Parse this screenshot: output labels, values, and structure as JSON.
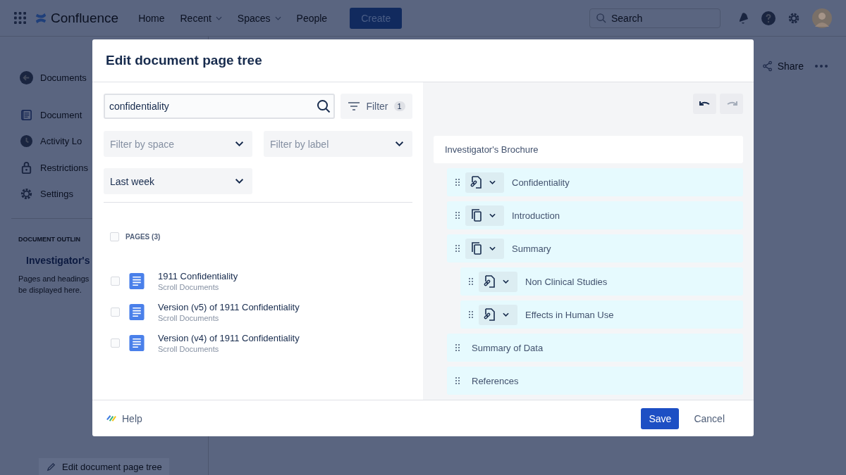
{
  "top_nav": {
    "product": "Confluence",
    "links": [
      {
        "label": "Home",
        "dropdown": false
      },
      {
        "label": "Recent",
        "dropdown": true
      },
      {
        "label": "Spaces",
        "dropdown": true
      },
      {
        "label": "People",
        "dropdown": false
      }
    ],
    "create": "Create",
    "search": {
      "placeholder": "Search"
    }
  },
  "sidebar": {
    "back": "Documents",
    "items": [
      {
        "label": "Document",
        "kind": "document"
      },
      {
        "label": "Activity Lo",
        "kind": "clock"
      },
      {
        "label": "Restrictions",
        "kind": "lock"
      },
      {
        "label": "Settings",
        "kind": "gear"
      }
    ],
    "outline_heading": "DOCUMENT OUTLIN",
    "outline_item": "Investigator's",
    "outline_note": [
      "Pages and headings",
      "be displayed here."
    ],
    "edit_link": "Edit document page tree"
  },
  "page_actions": {
    "share": "Share"
  },
  "dialog": {
    "title": "Edit document page tree",
    "search": {
      "value": "confidentiality"
    },
    "filter": {
      "label": "Filter",
      "count": "1"
    },
    "selects": [
      {
        "placeholder": "Filter by space"
      },
      {
        "placeholder": "Filter by label"
      },
      {
        "value": "Last week"
      }
    ],
    "pages": {
      "heading": "PAGES (3)",
      "checked": false,
      "results": [
        {
          "title": "1911 Confidentiality",
          "space": "Scroll Documents",
          "checked": false
        },
        {
          "title": "Version (v5) of 1911 Confidentiality",
          "space": "Scroll Documents",
          "checked": false
        },
        {
          "title": "Version (v4) of 1911 Confidentiality",
          "space": "Scroll Documents",
          "checked": false
        }
      ]
    },
    "history": {
      "undo_disabled": false,
      "redo_disabled": true
    },
    "tree": {
      "root": "Investigator's Brochure",
      "children": [
        {
          "label": "Confidentiality",
          "kind": "linked"
        },
        {
          "label": "Introduction",
          "kind": "copy"
        },
        {
          "label": "Summary",
          "kind": "copy",
          "children": [
            {
              "label": "Non Clinical Studies",
              "kind": "linked"
            },
            {
              "label": "Effects in Human Use",
              "kind": "linked"
            }
          ]
        },
        {
          "label": "Summary of Data",
          "kind": "plain"
        },
        {
          "label": "References",
          "kind": "plain"
        }
      ]
    },
    "help": "Help",
    "save": "Save",
    "cancel": "Cancel"
  }
}
